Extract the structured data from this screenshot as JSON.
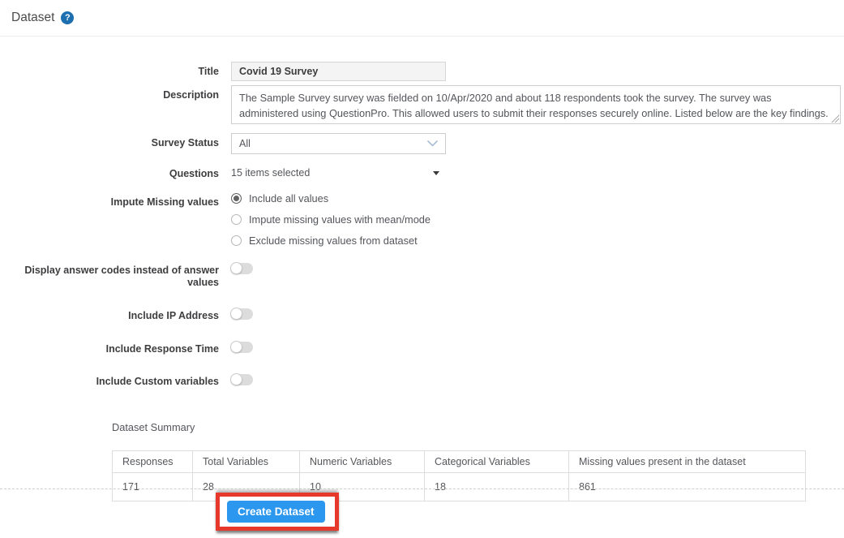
{
  "header": {
    "title": "Dataset"
  },
  "form": {
    "title": {
      "label": "Title",
      "value": "Covid 19 Survey"
    },
    "description": {
      "label": "Description",
      "value": "The Sample Survey survey was fielded on 10/Apr/2020 and about 118 respondents took the survey. The survey was administered using QuestionPro. This allowed users to submit their responses securely online. Listed below are the key findings."
    },
    "survey_status": {
      "label": "Survey Status",
      "value": "All"
    },
    "questions": {
      "label": "Questions",
      "value": "15 items selected"
    },
    "impute": {
      "label": "Impute Missing values",
      "options": [
        {
          "label": "Include all values",
          "selected": true
        },
        {
          "label": "Impute missing values with mean/mode",
          "selected": false
        },
        {
          "label": "Exclude missing values from dataset",
          "selected": false
        }
      ]
    },
    "toggles": [
      {
        "label": "Display answer codes instead of answer values",
        "on": false
      },
      {
        "label": "Include IP Address",
        "on": false
      },
      {
        "label": "Include Response Time",
        "on": false
      },
      {
        "label": "Include Custom variables",
        "on": false
      }
    ]
  },
  "summary": {
    "label": "Dataset Summary",
    "table": {
      "headers": [
        "Responses",
        "Total Variables",
        "Numeric Variables",
        "Categorical Variables",
        "Missing values present in the dataset"
      ],
      "values": [
        "171",
        "28",
        "10",
        "18",
        "861"
      ]
    }
  },
  "footer": {
    "create_button_label": "Create Dataset"
  },
  "colors": {
    "accent_blue": "#2b97ef",
    "annotation_red": "#e6392c",
    "help_icon_blue": "#1e6fb0"
  }
}
